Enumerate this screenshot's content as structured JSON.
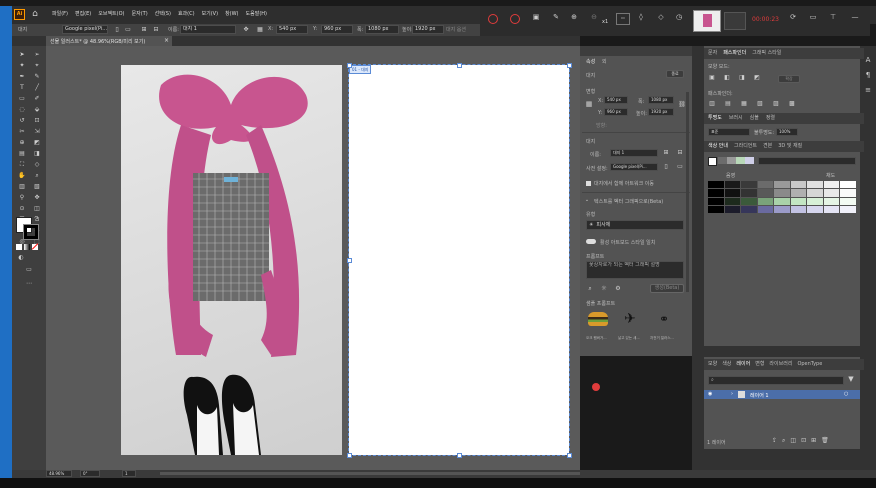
{
  "menu": [
    "파일(F)",
    "편집(E)",
    "오브젝트(O)",
    "문자(T)",
    "선택(S)",
    "효과(C)",
    "보기(V)",
    "창(W)",
    "도움말(H)"
  ],
  "app": {
    "logo": "Ai"
  },
  "recorder": {
    "time": "00:00:23",
    "zoom_label": "x1"
  },
  "control_bar": {
    "object_label": "대지",
    "preset": "Google pixel(Pi...",
    "name_label": "이름:",
    "name_value": "대지 1",
    "x_label": "X:",
    "x_value": "540 px",
    "y_label": "Y:",
    "y_value": "960 px",
    "w_label": "폭:",
    "w_value": "1080 px",
    "h_label": "높이:",
    "h_value": "1920 px",
    "options_button": "대지 옵션"
  },
  "document_tab": {
    "title": "선물 일러스트* @ 48.96%(RGB/미리 보기)",
    "close": "×"
  },
  "artboard_labels": {
    "artboard1": "01 - 대지"
  },
  "status_bar": {
    "zoom": "48.96%",
    "angle": "0°",
    "artboard_num": "1"
  },
  "properties_panel": {
    "tabs": [
      "속성",
      "외"
    ],
    "sections": {
      "artboard_title": "대지",
      "transform_title": "변형",
      "x_label": "X:",
      "x_value": "540 px",
      "y_label": "Y:",
      "y_value": "960 px",
      "w_label": "폭:",
      "w_value": "1080 px",
      "h_label": "높이:",
      "h_value": "1920 px",
      "orient_label": "방향:",
      "edit_button": "종료",
      "artboard_section": "대지",
      "name_label": "이름:",
      "name_value": "대지 1",
      "preset_label": "사전 설정:",
      "preset_value": "Google pixel(Pi...",
      "move_artwork": "대지에서 함께 아트워크 이동",
      "gen_title": "텍스트를 벡터 그래픽으로(Beta)",
      "type_label": "유형",
      "type_value": "피사체",
      "match_style": "활성 아트보드 스타일 일치",
      "prompt_label": "프롬프트",
      "prompt_text": "꽃상자로가 되는 벡터 그래픽 설명",
      "generate_button": "생성(Beta)",
      "sample_label": "샘플 프롬프트",
      "samples": [
        "오크 햄버거...",
        "날고 있는 새...",
        "자전거 일러스..."
      ]
    }
  },
  "swatch_panel": {
    "tabs": [
      "문자",
      "패스파인더",
      "그래픽 스타일"
    ],
    "shape_modes": "모양 모드:",
    "expand": "확장",
    "pathfinders": "패스파인더:",
    "tabs2": [
      "투명도",
      "브러시",
      "심볼",
      "정렬"
    ],
    "blend": "표준",
    "opacity_label": "불투명도:",
    "opacity_value": "100%",
    "tabs3": [
      "색상 안내",
      "그라디언트",
      "견본",
      "3D 및 재질"
    ],
    "col_head": [
      "음영",
      "채도"
    ]
  },
  "layers_panel": {
    "tabs": [
      "모양",
      "색상",
      "레이어",
      "변형",
      "라이브러리",
      "OpenType"
    ],
    "search_placeholder": "",
    "layer_name": "레이어 1",
    "footer_count": "1 레이어",
    "selected_layer_color": "#4b6ea9"
  },
  "colors": {
    "bg": "#1a1a1a",
    "menubar": "#2b2b2b",
    "panel": "#535353",
    "canvas": "#5a5a5a",
    "artboard": "#ffffff",
    "accent": "#4b6ea9",
    "pink": "#c8558f",
    "recorder_red": "#e03c3c"
  }
}
